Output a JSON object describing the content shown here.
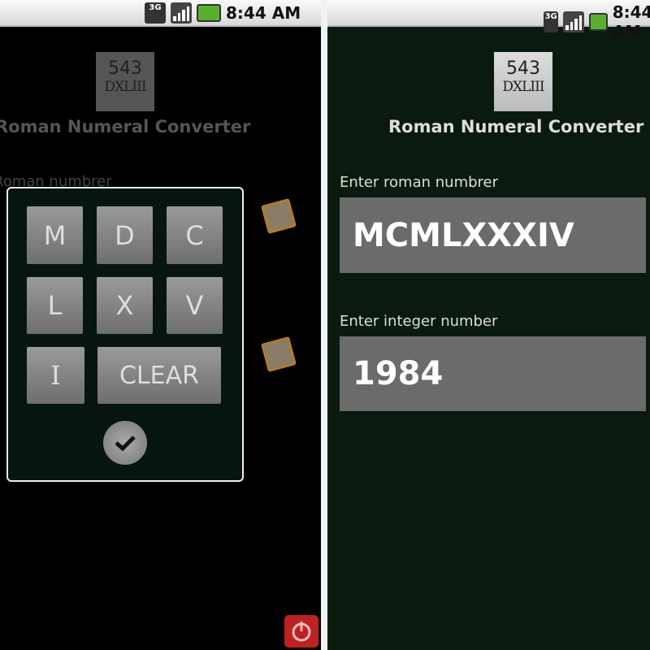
{
  "status_bar": {
    "network": "3G",
    "time": "8:44 AM"
  },
  "app": {
    "logo_number": "543",
    "logo_roman": "DXLIII",
    "title": "Roman Numeral Converter"
  },
  "left": {
    "background_label": "Roman numbrer",
    "keypad": {
      "keys": [
        "M",
        "D",
        "C",
        "L",
        "X",
        "V",
        "I",
        "CLEAR"
      ]
    }
  },
  "right": {
    "roman_label": "Enter roman numbrer",
    "roman_value": "MCMLXXXIV",
    "integer_label": "Enter integer number",
    "integer_value": "1984"
  }
}
